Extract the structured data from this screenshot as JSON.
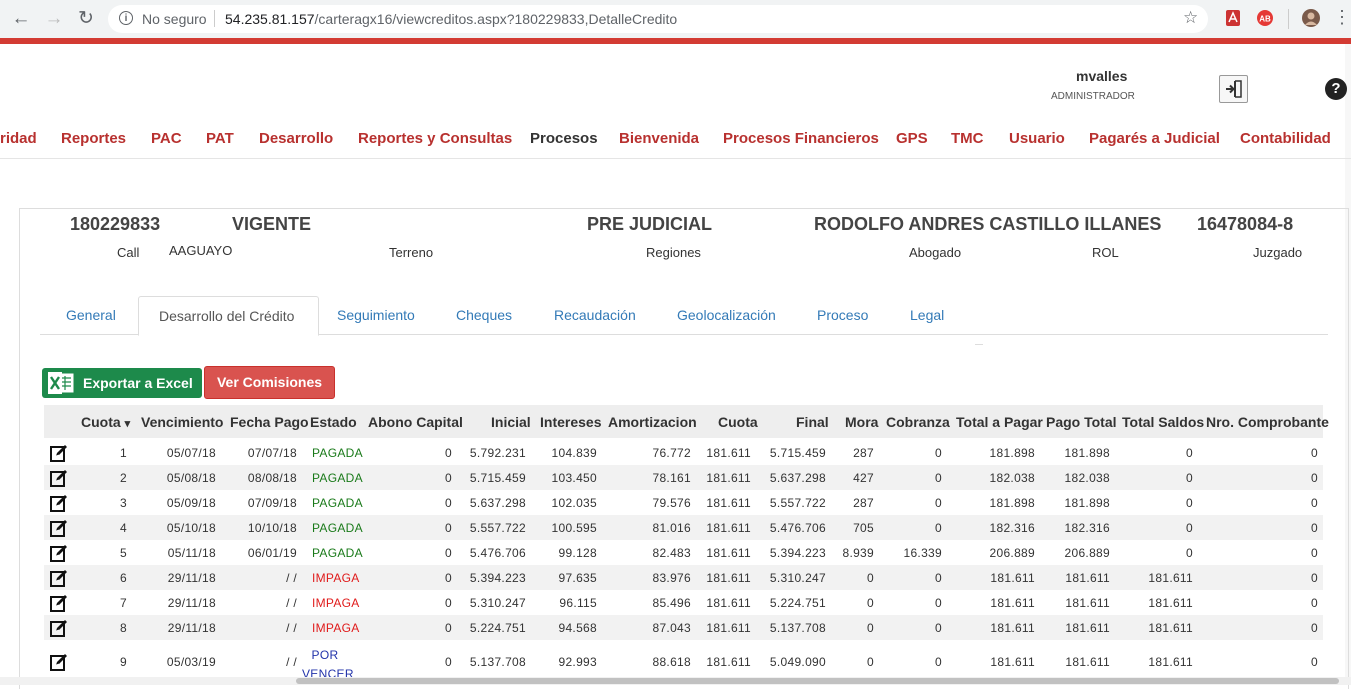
{
  "browser": {
    "security": "No seguro",
    "url_host": "54.235.81.157",
    "url_path": "/carteragx16/viewcreditos.aspx?180229833,DetalleCredito"
  },
  "user": {
    "name": "mvalles",
    "role": "ADMINISTRADOR"
  },
  "menu": [
    "ridad",
    "Reportes",
    "PAC",
    "PAT",
    "Desarrollo",
    "Reportes y Consultas",
    "Procesos",
    "Bienvenida",
    "Procesos Financieros",
    "GPS",
    "TMC",
    "Usuario",
    "Pagarés a Judicial",
    "Contabilidad"
  ],
  "credit": {
    "number": "180229833",
    "status": "VIGENTE",
    "stage": "PRE JUDICIAL",
    "client": "RODOLFO ANDRES CASTILLO ILLANES",
    "rut": "16478084-8",
    "call_label": "Call",
    "call_value": "AAGUAYO",
    "terreno_label": "Terreno",
    "regiones_label": "Regiones",
    "abogado_label": "Abogado",
    "rol_label": "ROL",
    "juzgado_label": "Juzgado"
  },
  "tabs": [
    "General",
    "Desarrollo del Crédito",
    "Seguimiento",
    "Cheques",
    "Recaudación",
    "Geolocalización",
    "Proceso",
    "Legal"
  ],
  "active_tab": "Desarrollo del Crédito",
  "buttons": {
    "export": "Exportar a Excel",
    "commissions": "Ver Comisiones"
  },
  "table": {
    "columns": [
      "Cuota",
      "Vencimiento",
      "Fecha Pago",
      "Estado",
      "Abono Capital",
      "Inicial",
      "Intereses",
      "Amortizacion",
      "Cuota",
      "Final",
      "Mora",
      "Cobranza",
      "Total a Pagar",
      "Pago Total",
      "Total Saldos",
      "Nro. Comprobante"
    ],
    "sort_indicator": "▾",
    "rows": [
      {
        "n": "1",
        "venc": "05/07/18",
        "pago": "07/07/18",
        "estado": "PAGADA",
        "abono": "0",
        "inicial": "5.792.231",
        "intereses": "104.839",
        "amort": "76.772",
        "cuota": "181.611",
        "final": "5.715.459",
        "mora": "287",
        "cobranza": "0",
        "total": "181.898",
        "pagototal": "181.898",
        "saldos": "0",
        "comprobante": "0"
      },
      {
        "n": "2",
        "venc": "05/08/18",
        "pago": "08/08/18",
        "estado": "PAGADA",
        "abono": "0",
        "inicial": "5.715.459",
        "intereses": "103.450",
        "amort": "78.161",
        "cuota": "181.611",
        "final": "5.637.298",
        "mora": "427",
        "cobranza": "0",
        "total": "182.038",
        "pagototal": "182.038",
        "saldos": "0",
        "comprobante": "0"
      },
      {
        "n": "3",
        "venc": "05/09/18",
        "pago": "07/09/18",
        "estado": "PAGADA",
        "abono": "0",
        "inicial": "5.637.298",
        "intereses": "102.035",
        "amort": "79.576",
        "cuota": "181.611",
        "final": "5.557.722",
        "mora": "287",
        "cobranza": "0",
        "total": "181.898",
        "pagototal": "181.898",
        "saldos": "0",
        "comprobante": "0"
      },
      {
        "n": "4",
        "venc": "05/10/18",
        "pago": "10/10/18",
        "estado": "PAGADA",
        "abono": "0",
        "inicial": "5.557.722",
        "intereses": "100.595",
        "amort": "81.016",
        "cuota": "181.611",
        "final": "5.476.706",
        "mora": "705",
        "cobranza": "0",
        "total": "182.316",
        "pagototal": "182.316",
        "saldos": "0",
        "comprobante": "0"
      },
      {
        "n": "5",
        "venc": "05/11/18",
        "pago": "06/01/19",
        "estado": "PAGADA",
        "abono": "0",
        "inicial": "5.476.706",
        "intereses": "99.128",
        "amort": "82.483",
        "cuota": "181.611",
        "final": "5.394.223",
        "mora": "8.939",
        "cobranza": "16.339",
        "total": "206.889",
        "pagototal": "206.889",
        "saldos": "0",
        "comprobante": "0"
      },
      {
        "n": "6",
        "venc": "29/11/18",
        "pago": "/ /",
        "estado": "IMPAGA",
        "abono": "0",
        "inicial": "5.394.223",
        "intereses": "97.635",
        "amort": "83.976",
        "cuota": "181.611",
        "final": "5.310.247",
        "mora": "0",
        "cobranza": "0",
        "total": "181.611",
        "pagototal": "181.611",
        "saldos": "181.611",
        "comprobante": "0"
      },
      {
        "n": "7",
        "venc": "29/11/18",
        "pago": "/ /",
        "estado": "IMPAGA",
        "abono": "0",
        "inicial": "5.310.247",
        "intereses": "96.115",
        "amort": "85.496",
        "cuota": "181.611",
        "final": "5.224.751",
        "mora": "0",
        "cobranza": "0",
        "total": "181.611",
        "pagototal": "181.611",
        "saldos": "181.611",
        "comprobante": "0"
      },
      {
        "n": "8",
        "venc": "29/11/18",
        "pago": "/ /",
        "estado": "IMPAGA",
        "abono": "0",
        "inicial": "5.224.751",
        "intereses": "94.568",
        "amort": "87.043",
        "cuota": "181.611",
        "final": "5.137.708",
        "mora": "0",
        "cobranza": "0",
        "total": "181.611",
        "pagototal": "181.611",
        "saldos": "181.611",
        "comprobante": "0"
      },
      {
        "n": "9",
        "venc": "05/03/19",
        "pago": "/ /",
        "estado": "POR VENCER",
        "estado_l1": "POR",
        "estado_l2": "VENCER",
        "abono": "0",
        "inicial": "5.137.708",
        "intereses": "92.993",
        "amort": "88.618",
        "cuota": "181.611",
        "final": "5.049.090",
        "mora": "0",
        "cobranza": "0",
        "total": "181.611",
        "pagototal": "181.611",
        "saldos": "181.611",
        "comprobante": "0"
      }
    ]
  },
  "colors": {
    "menu": "#b8312f",
    "paid": "#1a7a1a",
    "unpaid": "#e01b1b",
    "upcoming": "#2233aa",
    "link": "#337ab7",
    "excel": "#1d8a4b",
    "commissions": "#d9534f"
  }
}
